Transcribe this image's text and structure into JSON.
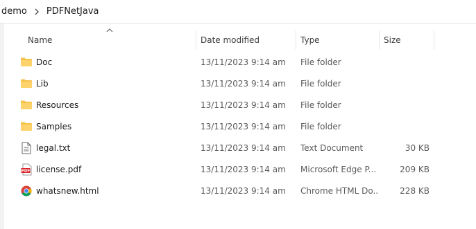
{
  "breadcrumb": {
    "items": [
      "demo",
      "PDFNetJava"
    ]
  },
  "columns": {
    "name": "Name",
    "date": "Date modified",
    "type": "Type",
    "size": "Size"
  },
  "files": [
    {
      "name": "Doc",
      "date": "13/11/2023 9:14 am",
      "type": "File folder",
      "size": "",
      "icon": "folder-icon"
    },
    {
      "name": "Lib",
      "date": "13/11/2023 9:14 am",
      "type": "File folder",
      "size": "",
      "icon": "folder-icon"
    },
    {
      "name": "Resources",
      "date": "13/11/2023 9:14 am",
      "type": "File folder",
      "size": "",
      "icon": "folder-icon"
    },
    {
      "name": "Samples",
      "date": "13/11/2023 9:14 am",
      "type": "File folder",
      "size": "",
      "icon": "folder-icon"
    },
    {
      "name": "legal.txt",
      "date": "13/11/2023 9:14 am",
      "type": "Text Document",
      "size": "30 KB",
      "icon": "text-file-icon"
    },
    {
      "name": "license.pdf",
      "date": "13/11/2023 9:14 am",
      "type": "Microsoft Edge P...",
      "size": "209 KB",
      "icon": "pdf-file-icon"
    },
    {
      "name": "whatsnew.html",
      "date": "13/11/2023 9:14 am",
      "type": "Chrome HTML Do...",
      "size": "228 KB",
      "icon": "chrome-html-icon"
    }
  ],
  "colors": {
    "folder": "#f5c24a",
    "pdf": "#d8262c",
    "chrome_red": "#db4437",
    "chrome_green": "#0f9d58",
    "chrome_yellow": "#f4b400",
    "chrome_blue": "#4285f4"
  }
}
